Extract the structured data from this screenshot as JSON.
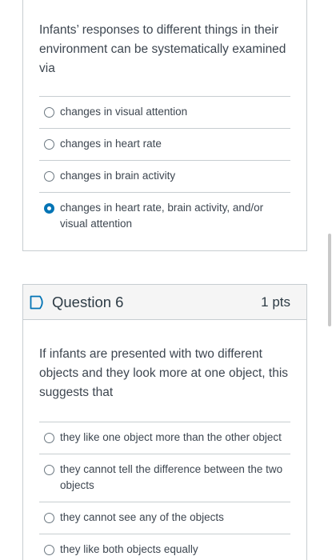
{
  "question5": {
    "text": "Infants’ responses to different things in their environment can be systematically examined via",
    "answers": [
      {
        "label": "changes in visual attention",
        "selected": false
      },
      {
        "label": "changes in heart rate",
        "selected": false
      },
      {
        "label": "changes in brain activity",
        "selected": false
      },
      {
        "label": "changes in heart rate, brain activity, and/or visual attention",
        "selected": true
      }
    ]
  },
  "question6": {
    "title": "Question 6",
    "points": "1 pts",
    "text": "If infants are presented with two different objects and they look more at one object, this suggests that",
    "answers": [
      {
        "label": "they like one object more than the other object",
        "selected": false
      },
      {
        "label": "they cannot tell the difference between the two objects",
        "selected": false
      },
      {
        "label": "they cannot see any of the objects",
        "selected": false
      },
      {
        "label": "they like both objects equally",
        "selected": false
      }
    ]
  },
  "colors": {
    "accent": "#0374b5",
    "border": "#c7cdd1",
    "text": "#3d4650",
    "header_bg": "#f5f5f5"
  },
  "icons": {
    "flag": "flag-icon"
  }
}
